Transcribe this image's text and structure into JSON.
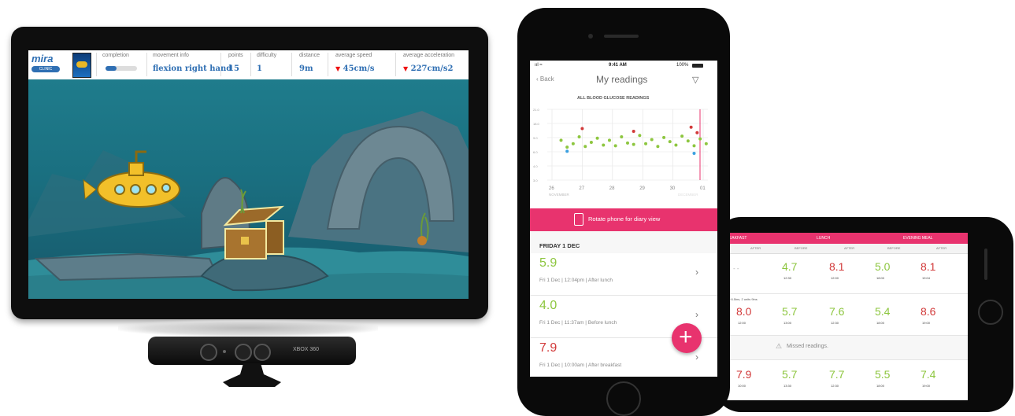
{
  "tv": {
    "hud": {
      "logo": "mira",
      "logo_sub": "CLINIC",
      "headers": [
        "completion",
        "movement info",
        "points",
        "difficulty",
        "distance",
        "average speed",
        "average acceleration"
      ],
      "movement_info": "flexion right hand",
      "points": "15",
      "difficulty": "1",
      "distance": "9m",
      "average_speed": "45cm/s",
      "average_acceleration": "227cm/s2",
      "completion_fraction": 0.35
    }
  },
  "kinect": {
    "brand": "XBOX 360"
  },
  "phone1": {
    "status": {
      "time": "9:41 AM",
      "battery": "100%"
    },
    "nav": {
      "back": "Back",
      "title": "My readings"
    },
    "chart_title": "ALL BLOOD GLUCOSE READINGS",
    "chart_data": {
      "type": "scatter",
      "title": "ALL BLOOD GLUCOSE READINGS",
      "x_tick_labels": [
        "26",
        "27",
        "28",
        "29",
        "30",
        "01"
      ],
      "x_month_labels": [
        "NOVEMBER",
        "DECEMBER"
      ],
      "y_tick_labels": [
        "21.0",
        "18.0",
        "9.0",
        "6.0",
        "4.0",
        "3.0"
      ],
      "series": [
        {
          "color": "#8dc63f",
          "values": [
            [
              0.3,
              5.5
            ],
            [
              0.5,
              4.5
            ],
            [
              0.7,
              5.0
            ],
            [
              0.9,
              6.0
            ],
            [
              1.1,
              4.6
            ],
            [
              1.3,
              5.2
            ],
            [
              1.5,
              5.8
            ],
            [
              1.7,
              4.8
            ],
            [
              1.9,
              5.5
            ],
            [
              2.1,
              4.7
            ],
            [
              2.3,
              6.0
            ],
            [
              2.5,
              5.1
            ],
            [
              2.7,
              4.9
            ],
            [
              2.9,
              6.2
            ],
            [
              3.1,
              5.0
            ],
            [
              3.3,
              5.6
            ],
            [
              3.5,
              4.6
            ],
            [
              3.7,
              5.9
            ],
            [
              3.9,
              5.3
            ],
            [
              4.1,
              4.8
            ],
            [
              4.3,
              6.1
            ],
            [
              4.5,
              5.4
            ],
            [
              4.7,
              4.7
            ],
            [
              4.9,
              5.7
            ],
            [
              5.1,
              5.0
            ]
          ]
        },
        {
          "color": "#d23a3a",
          "values": [
            [
              1.0,
              7.2
            ],
            [
              2.7,
              6.8
            ],
            [
              4.6,
              7.4
            ],
            [
              4.8,
              6.6
            ]
          ]
        },
        {
          "color": "#3aa0e0",
          "values": [
            [
              0.5,
              3.9
            ],
            [
              4.7,
              3.6
            ]
          ]
        }
      ]
    },
    "rotate_label": "Rotate phone for diary view",
    "day_label": "FRIDAY 1 DEC",
    "readings": [
      {
        "value": "5.9",
        "detail": "Fri 1 Dec | 12:04pm | After lunch"
      },
      {
        "value": "4.0",
        "detail": "Fri 1 Dec | 11:37am | Before lunch"
      },
      {
        "value": "7.9",
        "detail": "Fri 1 Dec | 10:00am | After breakfast"
      }
    ]
  },
  "phone2": {
    "headers": [
      "BREAKFAST",
      "LUNCH",
      "EVENING MEAL"
    ],
    "subheaders": [
      "AFTER",
      "BEFORE",
      "AFTER",
      "BEFORE",
      "AFTER"
    ],
    "row1": [
      {
        "value": "- -",
        "time": ""
      },
      {
        "value": "4.7",
        "time": "12:30"
      },
      {
        "value": "8.1",
        "time": "12:00"
      },
      {
        "value": "5.0",
        "time": "18:00"
      },
      {
        "value": "8.1",
        "time": "19:04"
      }
    ],
    "row2": [
      {
        "value": "8.0",
        "time": "12:00"
      },
      {
        "value": "5.7",
        "time": "13:00"
      },
      {
        "value": "7.6",
        "time": "12:30"
      },
      {
        "value": "5.4",
        "time": "18:00"
      },
      {
        "value": "8.6",
        "time": "19:00"
      }
    ],
    "missed": "Missed readings.",
    "row3": [
      {
        "value": "7.9",
        "time": "10:00"
      },
      {
        "value": "5.7",
        "time": "13:30"
      },
      {
        "value": "7.7",
        "time": "12:30"
      },
      {
        "value": "5.5",
        "time": "18:00"
      },
      {
        "value": "7.4",
        "time": "19:00"
      }
    ],
    "note": "…ked 6.5ins, 2 units 9ins"
  }
}
